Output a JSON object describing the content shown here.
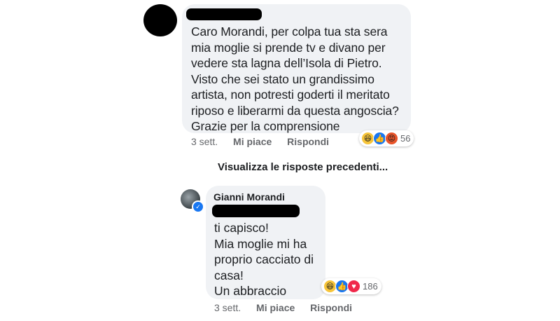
{
  "comment1": {
    "author_redacted": true,
    "lines": [
      "Caro Morandi, per colpa tua sta sera",
      "mia moglie si prende tv e divano per",
      "vedere sta lagna dell’Isola di Pietro.",
      "Visto che sei stato un grandissimo",
      "artista, non potresti goderti il meritato",
      "riposo e liberarmi da questa angoscia?",
      "Grazie per la comprensione"
    ],
    "time": "3 sett.",
    "like_label": "Mi piace",
    "reply_label": "Rispondi",
    "reactions": {
      "icons": [
        "haha-icon",
        "like-icon",
        "angry-icon"
      ],
      "count": "56"
    }
  },
  "view_previous_label": "Visualizza le risposte precedenti...",
  "reply": {
    "author": "Gianni Morandi",
    "verified": true,
    "lines": [
      "ti capisco!",
      "Mia moglie mi ha",
      "proprio cacciato di",
      "casa!",
      "Un abbraccio"
    ],
    "time": "3 sett.",
    "like_label": "Mi piace",
    "reply_label": "Rispondi",
    "reactions": {
      "icons": [
        "haha-icon",
        "like-icon",
        "love-icon"
      ],
      "count": "186"
    }
  },
  "colors": {
    "bubble": "#f0f2f5",
    "meta_text": "#65676b",
    "like_blue": "#1877f2",
    "angry": "#e8542a",
    "love": "#f0284a"
  }
}
